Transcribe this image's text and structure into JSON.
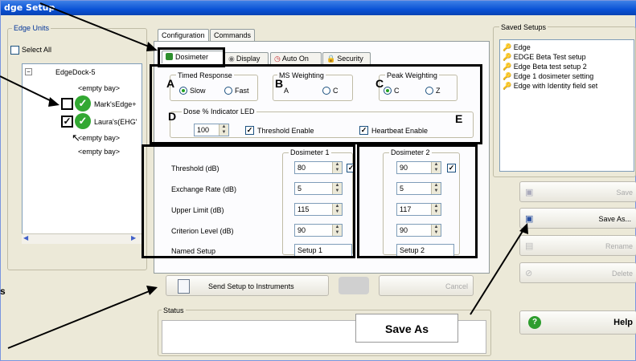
{
  "window": {
    "title": "dge Setup"
  },
  "edge_units": {
    "group_label": "Edge Units",
    "select_all_label": "Select All",
    "tree": {
      "root": "EdgeDock-5",
      "bays": [
        "<empty bay>",
        "Mark'sEdge+",
        "Laura's(EHG'",
        "<empty bay>",
        "<empty bay>"
      ]
    }
  },
  "tabs": {
    "configuration": "Configuration",
    "commands": "Commands"
  },
  "subtabs": {
    "dosimeter": "Dosimeter",
    "display": "Display",
    "auto_on": "Auto On",
    "security": "Security"
  },
  "timed_response": {
    "label": "Timed Response",
    "slow": "Slow",
    "fast": "Fast"
  },
  "rms_weighting": {
    "label": "MS Weighting",
    "a": "A",
    "c": "C"
  },
  "peak_weighting": {
    "label": "Peak Weighting",
    "c": "C",
    "z": "Z"
  },
  "dose_led": {
    "label": "Dose % Indicator LED",
    "value": "100",
    "threshold_enable": "Threshold Enable",
    "heartbeat_enable": "Heartbeat Enable"
  },
  "dosimeter1": {
    "label": "Dosimeter 1",
    "threshold": "80",
    "exchange_rate": "5",
    "upper_limit": "115",
    "criterion_level": "90",
    "named_setup": "Setup 1"
  },
  "dosimeter2": {
    "label": "Dosimeter 2",
    "threshold": "90",
    "exchange_rate": "5",
    "upper_limit": "117",
    "criterion_level": "90",
    "named_setup": "Setup 2"
  },
  "row_labels": {
    "threshold": "Threshold (dB)",
    "exchange_rate": "Exchange Rate (dB)",
    "upper_limit": "Upper Limit (dB)",
    "criterion_level": "Criterion Level (dB)",
    "named_setup": "Named Setup"
  },
  "buttons": {
    "send_setup": "Send Setup to Instruments",
    "cancel": "Cancel",
    "save": "Save",
    "save_as": "Save As...",
    "rename": "Rename",
    "delete": "Delete",
    "help": "Help"
  },
  "status": {
    "label": "Status"
  },
  "saved_setups": {
    "label": "Saved Setups",
    "items": [
      "Edge",
      "EDGE Beta Test setup",
      "Edge Beta test setup 2",
      "Edge 1 dosimeter setting",
      "Edge with Identity field set"
    ]
  },
  "annotations": {
    "letters": [
      "A",
      "B",
      "C",
      "D",
      "E"
    ],
    "save_as_callout": "Save As",
    "edge_label_s": "s"
  }
}
